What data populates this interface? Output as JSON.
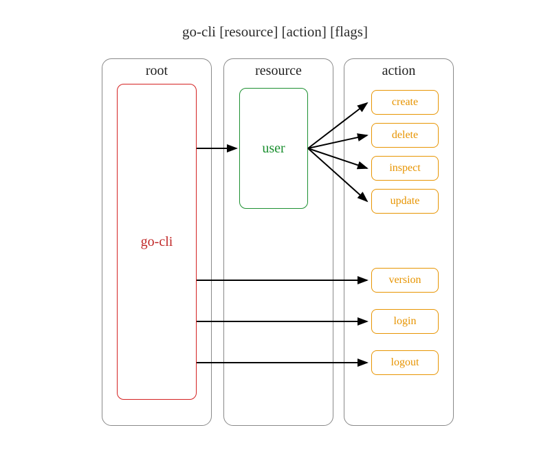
{
  "title": "go-cli [resource] [action] [flags]",
  "columns": {
    "root": {
      "label": "root"
    },
    "resource": {
      "label": "resource"
    },
    "action": {
      "label": "action"
    }
  },
  "nodes": {
    "root_cmd": "go-cli",
    "resource_user": "user",
    "actions_user": {
      "create": "create",
      "delete": "delete",
      "inspect": "inspect",
      "update": "update"
    },
    "actions_root": {
      "version": "version",
      "login": "login",
      "logout": "logout"
    }
  },
  "edges": [
    {
      "from": "root_cmd",
      "to": "resource_user"
    },
    {
      "from": "resource_user",
      "to": "create"
    },
    {
      "from": "resource_user",
      "to": "delete"
    },
    {
      "from": "resource_user",
      "to": "inspect"
    },
    {
      "from": "resource_user",
      "to": "update"
    },
    {
      "from": "root_cmd",
      "to": "version"
    },
    {
      "from": "root_cmd",
      "to": "login"
    },
    {
      "from": "root_cmd",
      "to": "logout"
    }
  ]
}
